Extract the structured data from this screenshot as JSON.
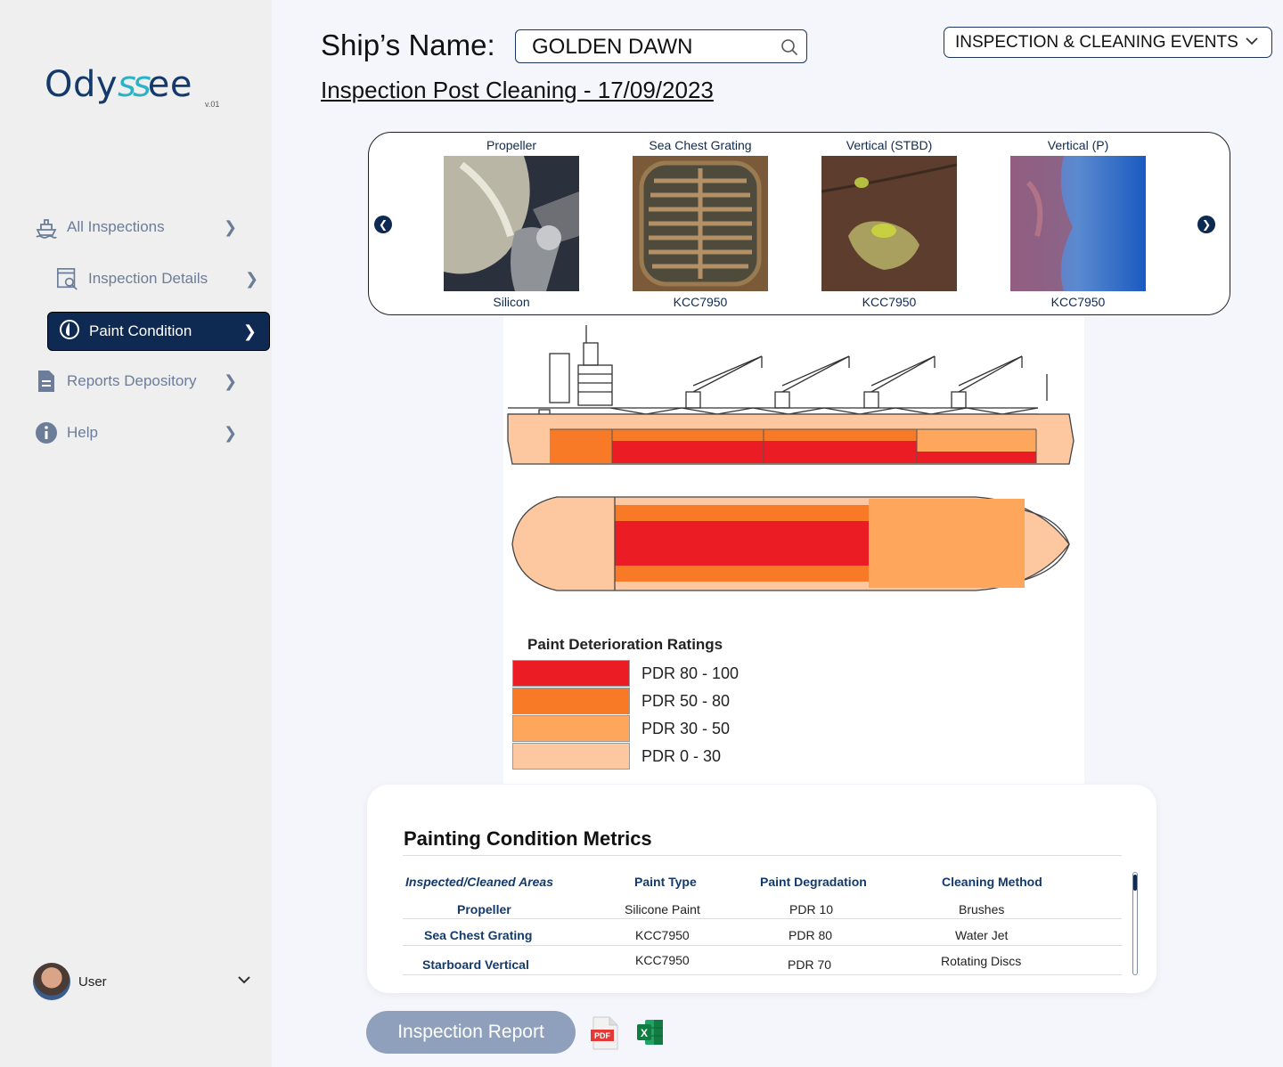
{
  "app": {
    "logo_prefix": "Ody",
    "logo_waves": "ss",
    "logo_suffix": "ee",
    "version": "v.01"
  },
  "sidebar": {
    "items": [
      {
        "label": "All Inspections",
        "icon": "ship-icon"
      },
      {
        "label": "Inspection Details",
        "icon": "search-document-icon"
      },
      {
        "label": "Paint Condition",
        "icon": "drop-icon",
        "active": true
      },
      {
        "label": "Reports Depository",
        "icon": "document-icon"
      },
      {
        "label": "Help",
        "icon": "info-icon"
      }
    ],
    "user": {
      "name": "User"
    }
  },
  "header": {
    "ship_label": "Ship’s Name:",
    "ship_name": "GOLDEN DAWN",
    "events_select": "INSPECTION & CLEANING EVENTS",
    "subtitle": "Inspection Post Cleaning - 17/09/2023"
  },
  "gallery": {
    "items": [
      {
        "title": "Propeller",
        "caption": "Silicon"
      },
      {
        "title": "Sea Chest Grating",
        "caption": "KCC7950"
      },
      {
        "title": "Vertical (STBD)",
        "caption": "KCC7950"
      },
      {
        "title": "Vertical (P)",
        "caption": "KCC7950"
      }
    ]
  },
  "legend": {
    "title": "Paint Deterioration Ratings",
    "items": [
      {
        "label": "PDR 80 - 100",
        "color": "#ec1c24"
      },
      {
        "label": "PDR 50 - 80",
        "color": "#f97a26"
      },
      {
        "label": "PDR 30 - 50",
        "color": "#fea65c"
      },
      {
        "label": "PDR 0 - 30",
        "color": "#fdc8a0"
      }
    ]
  },
  "metrics": {
    "title": "Painting Condition Metrics",
    "headers": [
      "Inspected/Cleaned Areas",
      "Paint Type",
      "Paint Degradation",
      "Cleaning Method"
    ],
    "rows": [
      [
        "Propeller",
        "Silicone Paint",
        "PDR 10",
        "Brushes"
      ],
      [
        "Sea Chest Grating",
        "KCC7950",
        "PDR 80",
        "Water Jet"
      ],
      [
        "Starboard Vertical",
        "KCC7950",
        "PDR 70",
        "Rotating Discs"
      ]
    ]
  },
  "actions": {
    "report_button": "Inspection Report",
    "pdf_label": "PDF",
    "excel_label": "X"
  }
}
